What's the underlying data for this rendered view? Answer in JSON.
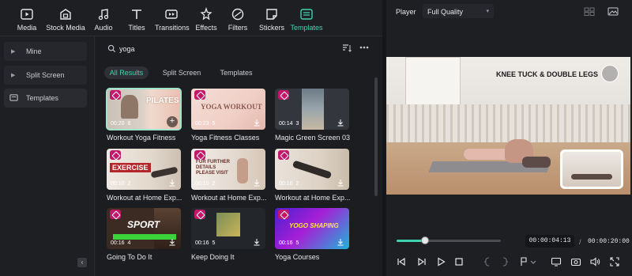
{
  "toolbar": {
    "items": [
      {
        "label": "Media",
        "icon": "media-icon"
      },
      {
        "label": "Stock Media",
        "icon": "stock-media-icon"
      },
      {
        "label": "Audio",
        "icon": "audio-icon"
      },
      {
        "label": "Titles",
        "icon": "titles-icon"
      },
      {
        "label": "Transitions",
        "icon": "transitions-icon"
      },
      {
        "label": "Effects",
        "icon": "effects-icon"
      },
      {
        "label": "Filters",
        "icon": "filters-icon"
      },
      {
        "label": "Stickers",
        "icon": "stickers-icon"
      },
      {
        "label": "Templates",
        "icon": "templates-icon",
        "active": true
      }
    ]
  },
  "sidebar": {
    "items": [
      {
        "label": "Mine"
      },
      {
        "label": "Split Screen"
      },
      {
        "label": "Templates"
      }
    ]
  },
  "search": {
    "value": "yoga",
    "placeholder": "Search"
  },
  "filters": {
    "chips": [
      "All Results",
      "Split Screen",
      "Templates"
    ],
    "active": "All Results"
  },
  "templates": [
    {
      "title": "Workout Yoga Fitness",
      "duration": "00:20",
      "count": "8",
      "thumb_text": "PILATES & CARDIO"
    },
    {
      "title": "Yoga Fitness Classes",
      "duration": "00:23",
      "count": "5",
      "thumb_text": "YOGA WORKOUT"
    },
    {
      "title": "Magic Green Screen 03",
      "duration": "00:14",
      "count": "3",
      "thumb_text": ""
    },
    {
      "title": "Workout at Home Exp...",
      "duration": "00:10",
      "count": "2",
      "thumb_text": "EXERCISE"
    },
    {
      "title": "Workout at Home Exp...",
      "duration": "00:10",
      "count": "2",
      "thumb_text": "FOR FURTHER DETAILS PLEASE VISIT"
    },
    {
      "title": "Workout at Home Exp...",
      "duration": "00:10",
      "count": "2",
      "thumb_text": ""
    },
    {
      "title": "Going To Do It",
      "duration": "00:16",
      "count": "4",
      "thumb_text": "SPORT"
    },
    {
      "title": "Keep Doing It",
      "duration": "00:16",
      "count": "5",
      "thumb_text": ""
    },
    {
      "title": "Yoga Courses",
      "duration": "00:16",
      "count": "5",
      "thumb_text": "YOGO SHAPING"
    }
  ],
  "player": {
    "label": "Player",
    "quality": "Full Quality",
    "video_caption": "KNEE TUCK & DOUBLE LEGS",
    "current_time": "00:00:04:13",
    "separator": "/",
    "total_time": "00:00:20:00",
    "progress": 0.27
  },
  "colors": {
    "accent": "#3ed3b0",
    "badge": "#c2176b",
    "panel": "#1e1f23"
  }
}
